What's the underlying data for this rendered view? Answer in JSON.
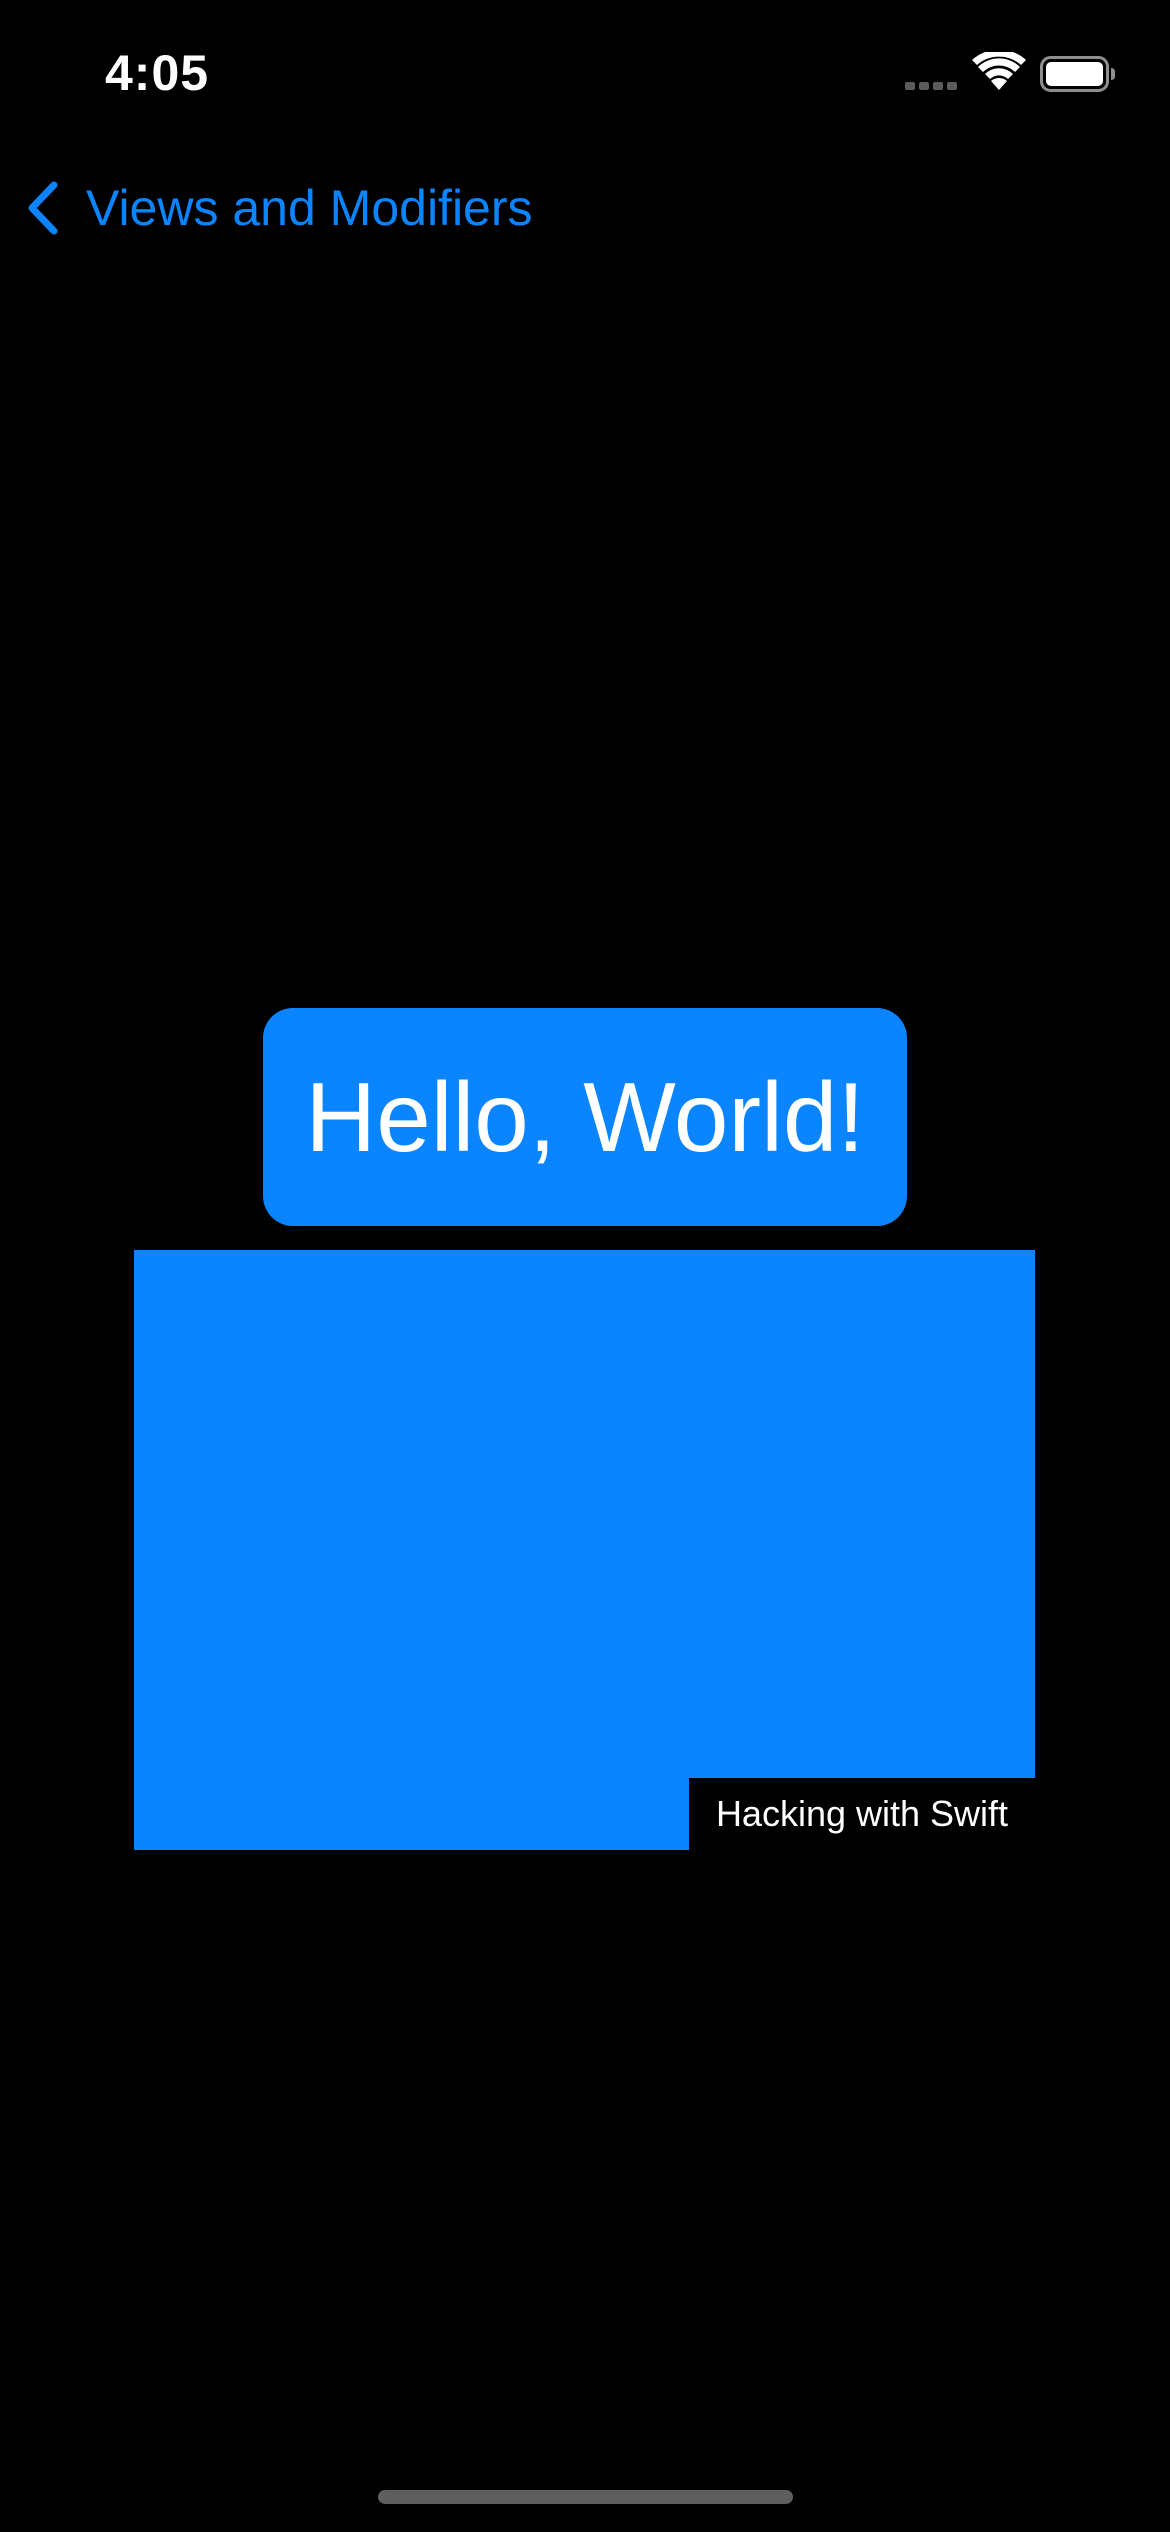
{
  "status_bar": {
    "time": "4:05",
    "icons": [
      "cellular-signal-icon",
      "wifi-icon",
      "battery-icon"
    ]
  },
  "navigation": {
    "back_label": "Views and Modifiers",
    "back_icon": "chevron-left-icon"
  },
  "content": {
    "hello_text": "Hello, World!",
    "overlay_text": "Hacking with Swift"
  },
  "colors": {
    "background": "#000000",
    "accent": "#0a84ff",
    "text": "#ffffff",
    "home_indicator": "#5e5e5e"
  }
}
